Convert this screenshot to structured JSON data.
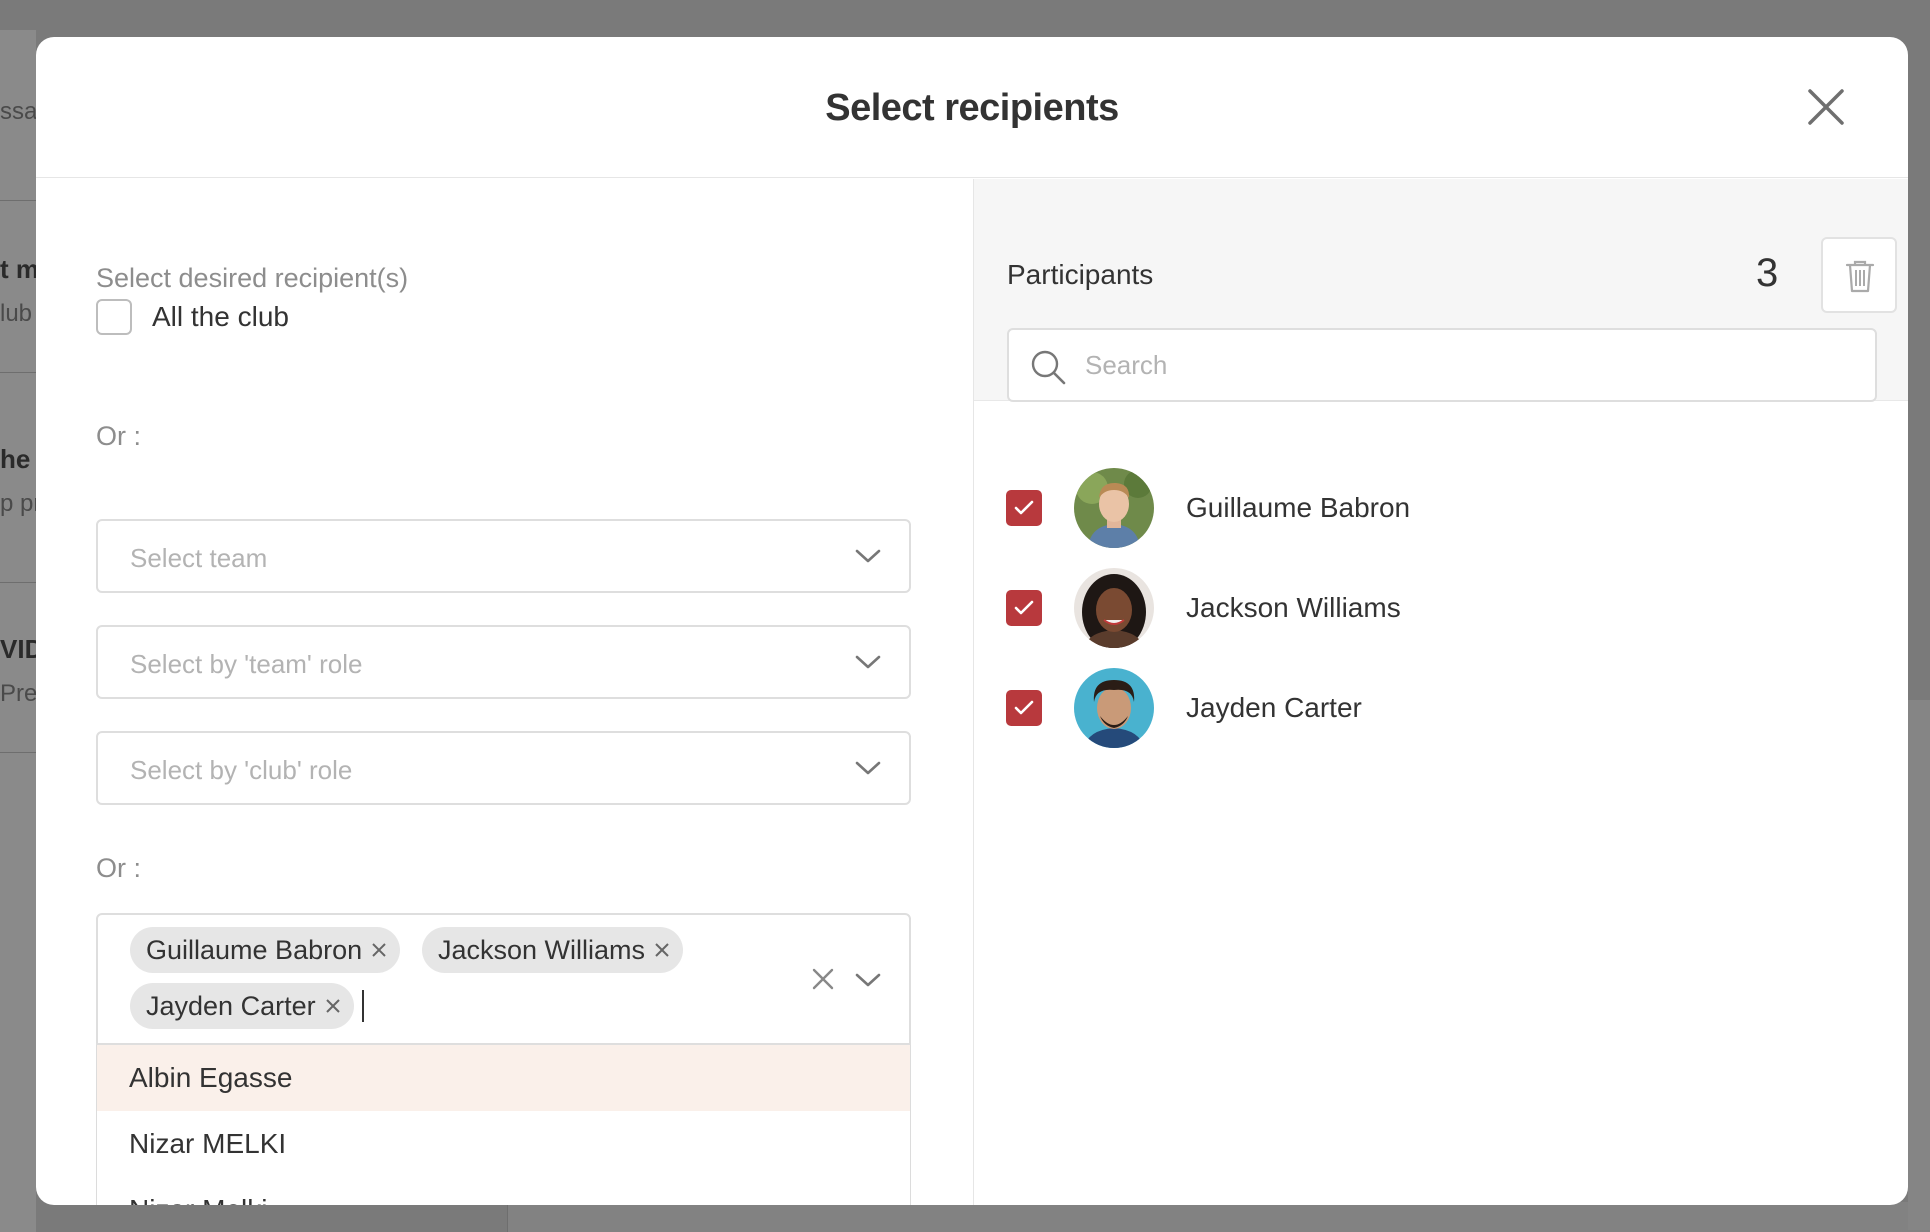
{
  "background": {
    "left_fragments": [
      {
        "text": "ssa",
        "kind": "sub"
      },
      {
        "text": "t m",
        "kind": "bold"
      },
      {
        "text": "lub",
        "kind": "sub"
      },
      {
        "text": "he",
        "kind": "bold"
      },
      {
        "text": "p pr",
        "kind": "sub"
      },
      {
        "text": "VID",
        "kind": "bold"
      },
      {
        "text": "Pre",
        "kind": "sub"
      }
    ]
  },
  "modal": {
    "title": "Select recipients",
    "close_icon": "close-icon"
  },
  "left": {
    "section_label": "Select desired recipient(s)",
    "all_club": {
      "label": "All the club",
      "checked": false
    },
    "or_label_1": "Or :",
    "or_label_2": "Or :",
    "selects": [
      {
        "placeholder": "Select team"
      },
      {
        "placeholder": "Select by 'team' role"
      },
      {
        "placeholder": "Select by 'club' role"
      }
    ],
    "selected_tags": [
      {
        "label": "Guillaume Babron"
      },
      {
        "label": "Jackson Williams"
      },
      {
        "label": "Jayden Carter"
      }
    ],
    "dropdown_options": [
      {
        "label": "Albin Egasse",
        "highlighted": true
      },
      {
        "label": "Nizar MELKI",
        "highlighted": false
      },
      {
        "label": "Nizar Melki",
        "highlighted": false
      }
    ]
  },
  "right": {
    "participants_title": "Participants",
    "participants_count": "3",
    "trash_icon": "trash-icon",
    "search_placeholder": "Search",
    "participants": [
      {
        "name": "Guillaume Babron",
        "checked": true
      },
      {
        "name": "Jackson Williams",
        "checked": true
      },
      {
        "name": "Jayden Carter",
        "checked": true
      }
    ]
  },
  "colors": {
    "accent": "#b8393d",
    "highlight": "#faf0ea",
    "tag_bg": "#e6e6e6"
  }
}
